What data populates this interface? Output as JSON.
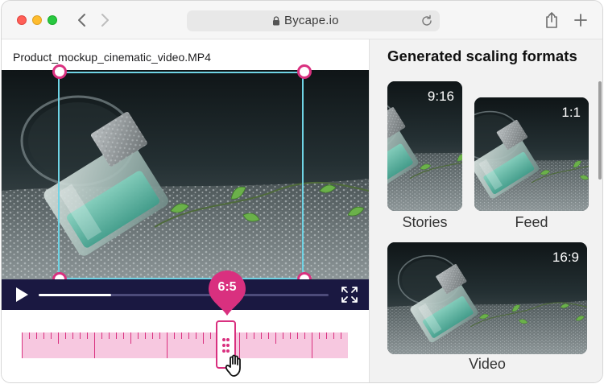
{
  "browser": {
    "url": "Bycape.io",
    "icons": [
      "back-icon",
      "forward-icon",
      "lock-icon",
      "reload-icon",
      "share-icon",
      "plus-icon"
    ]
  },
  "editor": {
    "filename": "Product_mockup_cinematic_video.MP4",
    "aspect_ratio": "6:5",
    "playback_progress": 0.25,
    "colors": {
      "accent": "#d9307f",
      "crop_border": "#6fd3e4",
      "controls_bg": "#1a1841",
      "ruler": "#f7c8e0"
    }
  },
  "panel": {
    "title": "Generated scaling formats",
    "formats": [
      {
        "ratio": "9:16",
        "label": "Stories"
      },
      {
        "ratio": "1:1",
        "label": "Feed"
      },
      {
        "ratio": "16:9",
        "label": "Video"
      }
    ]
  }
}
